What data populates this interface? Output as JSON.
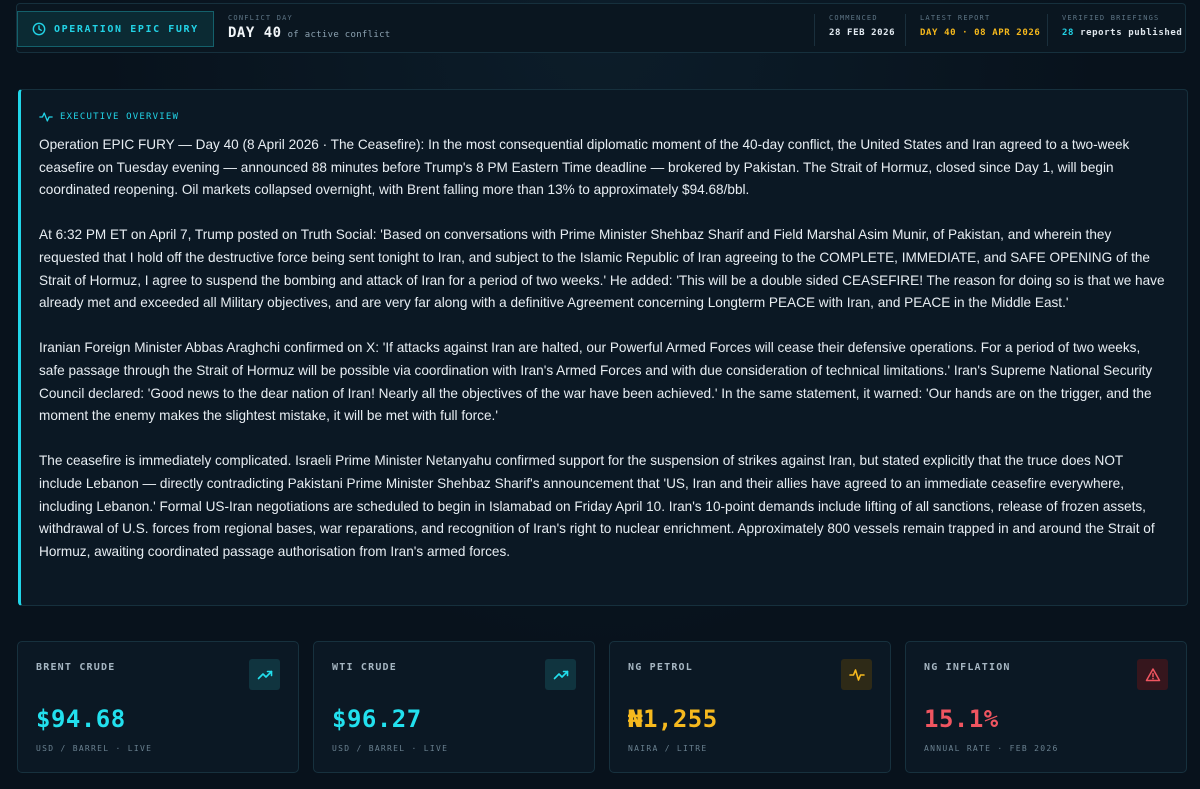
{
  "header": {
    "operation_label": "OPERATION EPIC FURY",
    "conflict_day_label": "CONFLICT DAY",
    "day_value": "DAY 40",
    "day_suffix": "of active conflict",
    "commenced_label": "COMMENCED",
    "commenced_value": "28 FEB 2026",
    "latest_label": "LATEST REPORT",
    "latest_value": "DAY 40 · 08 APR 2026",
    "verified_label": "VERIFIED BRIEFINGS",
    "verified_count": "28",
    "verified_suffix": "reports published"
  },
  "overview": {
    "title": "EXECUTIVE OVERVIEW",
    "paragraphs": [
      "Operation EPIC FURY — Day 40 (8 April 2026 · The Ceasefire): In the most consequential diplomatic moment of the 40-day conflict, the United States and Iran agreed to a two-week ceasefire on Tuesday evening — announced 88 minutes before Trump's 8 PM Eastern Time deadline — brokered by Pakistan. The Strait of Hormuz, closed since Day 1, will begin coordinated reopening. Oil markets collapsed overnight, with Brent falling more than 13% to approximately $94.68/bbl.",
      "At 6:32 PM ET on April 7, Trump posted on Truth Social: 'Based on conversations with Prime Minister Shehbaz Sharif and Field Marshal Asim Munir, of Pakistan, and wherein they requested that I hold off the destructive force being sent tonight to Iran, and subject to the Islamic Republic of Iran agreeing to the COMPLETE, IMMEDIATE, and SAFE OPENING of the Strait of Hormuz, I agree to suspend the bombing and attack of Iran for a period of two weeks.' He added: 'This will be a double sided CEASEFIRE! The reason for doing so is that we have already met and exceeded all Military objectives, and are very far along with a definitive Agreement concerning Longterm PEACE with Iran, and PEACE in the Middle East.'",
      "Iranian Foreign Minister Abbas Araghchi confirmed on X: 'If attacks against Iran are halted, our Powerful Armed Forces will cease their defensive operations. For a period of two weeks, safe passage through the Strait of Hormuz will be possible via coordination with Iran's Armed Forces and with due consideration of technical limitations.' Iran's Supreme National Security Council declared: 'Good news to the dear nation of Iran! Nearly all the objectives of the war have been achieved.' In the same statement, it warned: 'Our hands are on the trigger, and the moment the enemy makes the slightest mistake, it will be met with full force.'",
      "The ceasefire is immediately complicated. Israeli Prime Minister Netanyahu confirmed support for the suspension of strikes against Iran, but stated explicitly that the truce does NOT include Lebanon — directly contradicting Pakistani Prime Minister Shehbaz Sharif's announcement that 'US, Iran and their allies have agreed to an immediate ceasefire everywhere, including Lebanon.' Formal US-Iran negotiations are scheduled to begin in Islamabad on Friday April 10. Iran's 10-point demands include lifting of all sanctions, release of frozen assets, withdrawal of U.S. forces from regional bases, war reparations, and recognition of Iran's right to nuclear enrichment. Approximately 800 vessels remain trapped in and around the Strait of Hormuz, awaiting coordinated passage authorisation from Iran's armed forces."
    ]
  },
  "cards": [
    {
      "label": "BRENT CRUDE",
      "value": "$94.68",
      "sub": "USD / BARREL · LIVE",
      "icon": "trending-up-icon",
      "color": "#22e0ee"
    },
    {
      "label": "WTI CRUDE",
      "value": "$96.27",
      "sub": "USD / BARREL · LIVE",
      "icon": "trending-up-icon",
      "color": "#22e0ee"
    },
    {
      "label": "NG PETROL",
      "value": "₦1,255",
      "sub": "NAIRA / LITRE",
      "icon": "pulse-icon",
      "color": "#f6b91e"
    },
    {
      "label": "NG INFLATION",
      "value": "15.1%",
      "sub": "ANNUAL RATE · FEB 2026",
      "icon": "alert-triangle-icon",
      "color": "#f05560"
    }
  ]
}
